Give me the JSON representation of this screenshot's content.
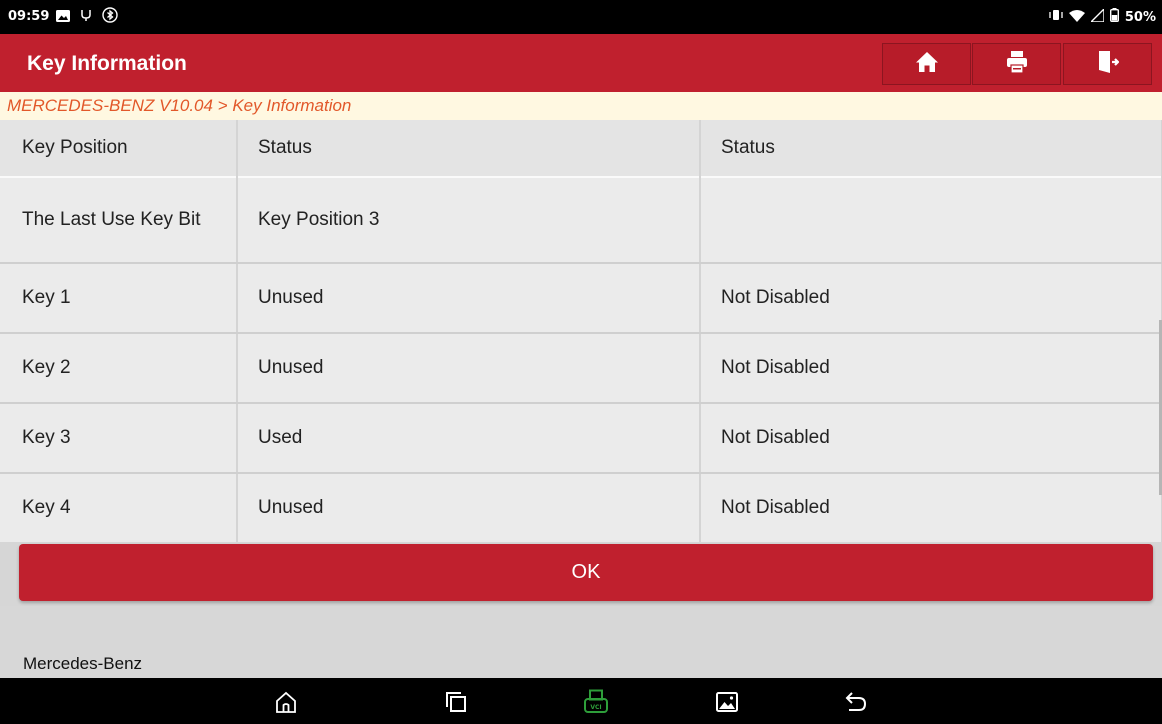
{
  "status_bar": {
    "time": "09:59",
    "left_icons": [
      "gallery-icon",
      "usb-debug-icon",
      "bluetooth-icon"
    ],
    "right_icons": [
      "vibrate-icon",
      "wifi-icon",
      "signal-icon",
      "battery-icon"
    ],
    "battery": "50%"
  },
  "header": {
    "title": "Key Information",
    "buttons": [
      "home-icon",
      "print-icon",
      "exit-icon"
    ]
  },
  "breadcrumb": "MERCEDES-BENZ V10.04 > Key Information",
  "table": {
    "columns": [
      "Key Position",
      "Status",
      "Status"
    ],
    "rows": [
      [
        "The Last Use Key Bit",
        "Key Position 3",
        ""
      ],
      [
        "Key 1",
        "Unused",
        "Not Disabled"
      ],
      [
        "Key 2",
        "Unused",
        "Not Disabled"
      ],
      [
        "Key 3",
        "Used",
        "Not Disabled"
      ],
      [
        "Key 4",
        "Unused",
        "Not Disabled"
      ]
    ]
  },
  "ok_button": "OK",
  "footer_text": "Mercedes-Benz",
  "nav_bar": [
    "home-nav-icon",
    "recents-icon",
    "vci-icon",
    "gallery-nav-icon",
    "back-icon"
  ],
  "colors": {
    "header_red": "#c0202e",
    "breadcrumb_text": "#e2582a",
    "breadcrumb_bg": "#fff8e1",
    "vci_green": "#2e9e3a"
  }
}
